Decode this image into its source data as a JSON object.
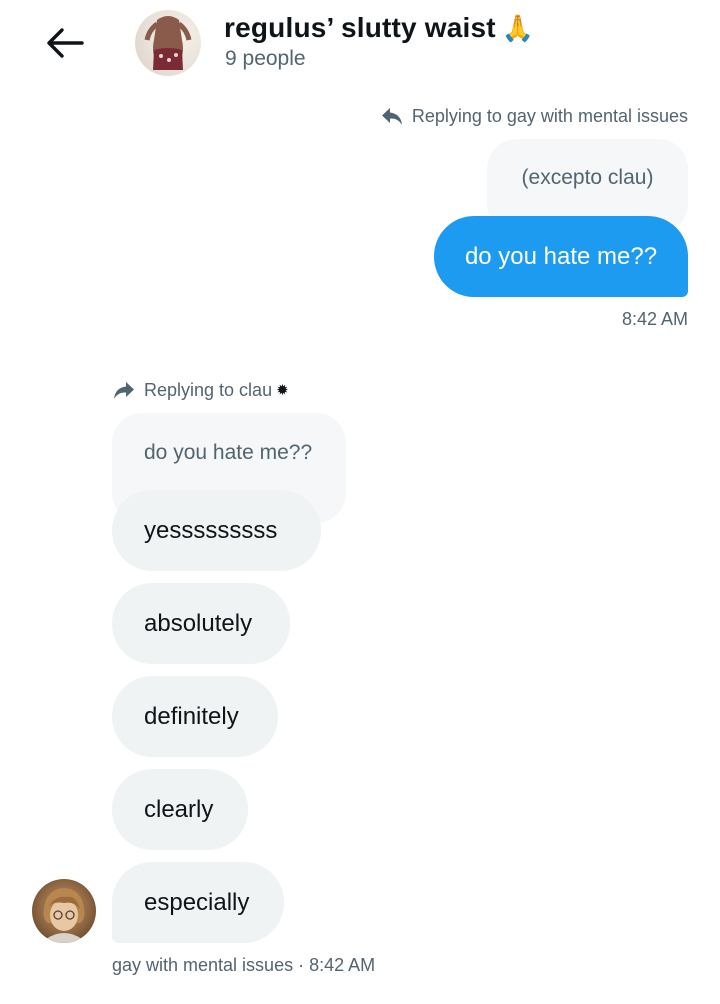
{
  "header": {
    "title": "regulus’ slutty waist",
    "title_emoji": "🙏",
    "subtitle": "9 people"
  },
  "messages": {
    "sent": {
      "reply_label": "Replying to gay with mental issues",
      "quoted_text": "(excepto clau)",
      "text": "do you hate me??",
      "time": "8:42 AM"
    },
    "received": {
      "reply_label": "Replying to clau",
      "reply_badge": "✹",
      "quoted_text": "do you hate me??",
      "bubbles": [
        "yesssssssss",
        "absolutely",
        "definitely",
        "clearly",
        "especially"
      ],
      "footer": "gay with mental issues · 8:42 AM"
    }
  },
  "colors": {
    "accent": "#1d9bf0",
    "muted": "#536471",
    "bubble_gray": "#eff3f4",
    "quote_gray": "#f5f7f8"
  }
}
